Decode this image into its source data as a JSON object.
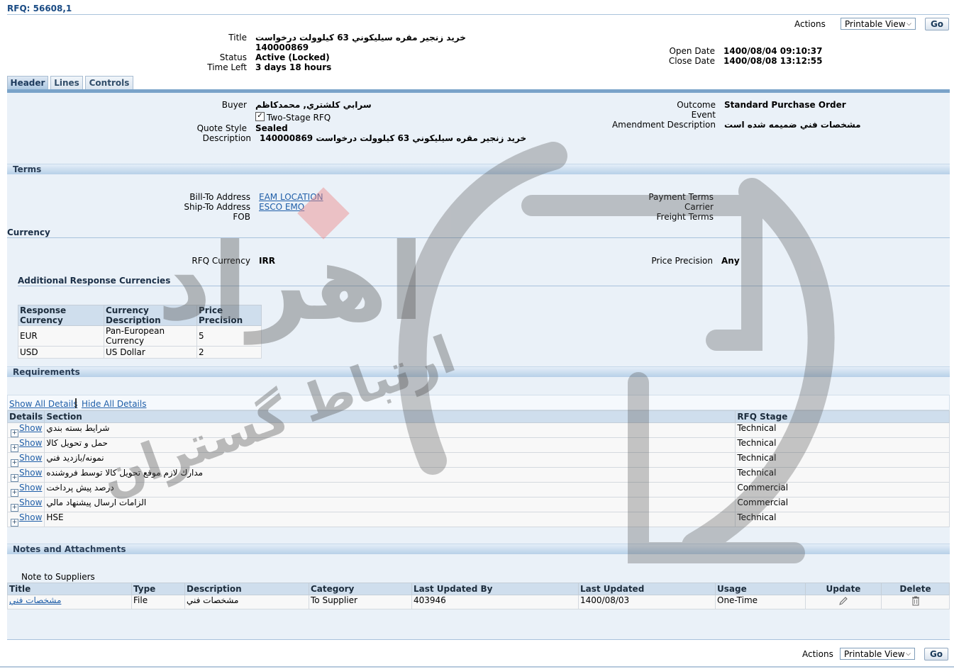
{
  "page": {
    "rfq_title": "RFQ: 56608,1"
  },
  "actions": {
    "label": "Actions",
    "select_value": "Printable View",
    "go_label": "Go"
  },
  "summary": {
    "title_label": "Title",
    "title_value": "خريد زنجير مقره سيليكوني 63 كيلوولت درخواست",
    "title_number": "140000869",
    "status_label": "Status",
    "status_value": "Active (Locked)",
    "time_left_label": "Time Left",
    "time_left_value": "3 days 18 hours",
    "open_date_label": "Open Date",
    "open_date_value": "1400/08/04 09:10:37",
    "close_date_label": "Close Date",
    "close_date_value": "1400/08/08 13:12:55"
  },
  "tabs": [
    "Header",
    "Lines",
    "Controls"
  ],
  "header": {
    "buyer_label": "Buyer",
    "buyer_value": "سرابي كلشتري, محمدكاظم",
    "two_stage_label": "Two-Stage RFQ",
    "quote_style_label": "Quote Style",
    "quote_style_value": "Sealed",
    "description_label": "Description",
    "description_value": "خريد زنجير مقره سيليكوني 63 كيلوولت درخواست 140000869",
    "outcome_label": "Outcome",
    "outcome_value": "Standard Purchase Order",
    "event_label": "Event",
    "amendment_label": "Amendment Description",
    "amendment_value": "مشخصات فني ضميمه شده است"
  },
  "terms": {
    "section_title": "Terms",
    "bill_to_label": "Bill-To Address",
    "bill_to_value": "EAM LOCATION",
    "ship_to_label": "Ship-To Address",
    "ship_to_value": "ESCO EMO",
    "fob_label": "FOB",
    "payment_terms_label": "Payment Terms",
    "carrier_label": "Carrier",
    "freight_terms_label": "Freight Terms"
  },
  "currency": {
    "section_title": "Currency",
    "rfq_currency_label": "RFQ Currency",
    "rfq_currency_value": "IRR",
    "price_precision_label": "Price Precision",
    "price_precision_value": "Any",
    "additional_title": "Additional Response Currencies",
    "columns": [
      "Response Currency",
      "Currency Description",
      "Price Precision"
    ],
    "rows": [
      [
        "EUR",
        "Pan-European Currency",
        "5"
      ],
      [
        "USD",
        "US Dollar",
        "2"
      ]
    ]
  },
  "requirements": {
    "section_title": "Requirements",
    "show_all": "Show All Details",
    "hide_all": "Hide All Details",
    "columns": [
      "Details",
      "Section",
      "RFQ Stage"
    ],
    "show_label": "Show",
    "rows": [
      {
        "section": "شرايط بسته بندي",
        "stage": "Technical"
      },
      {
        "section": "حمل و تحويل كالا",
        "stage": "Technical"
      },
      {
        "section": "نمونه/بازديد فني",
        "stage": "Technical"
      },
      {
        "section": "مدارك لازم موقع تحويل كالا توسط فروشنده",
        "stage": "Technical"
      },
      {
        "section": "درصد پيش پرداخت",
        "stage": "Commercial"
      },
      {
        "section": "الزامات ارسال پيشنهاد مالي",
        "stage": "Commercial"
      },
      {
        "section": "HSE",
        "stage": "Technical"
      }
    ]
  },
  "notes": {
    "section_title": "Notes and Attachments",
    "note_label": "Note to Suppliers",
    "columns": [
      "Title",
      "Type",
      "Description",
      "Category",
      "Last Updated By",
      "Last Updated",
      "Usage",
      "Update",
      "Delete"
    ],
    "rows": [
      {
        "title": "مشخصات فني",
        "type": "File",
        "description": "مشخصات فني",
        "category": "To Supplier",
        "updated_by": "403946",
        "updated": "1400/08/03",
        "usage": "One-Time"
      }
    ]
  },
  "watermark": {
    "text_main": "اهراد",
    "text_sub": "ارتباط گستران"
  },
  "colors": {
    "link": "#1f5ea8",
    "section_bar": "#b7d0e8",
    "panel": "#eaf1f8"
  }
}
